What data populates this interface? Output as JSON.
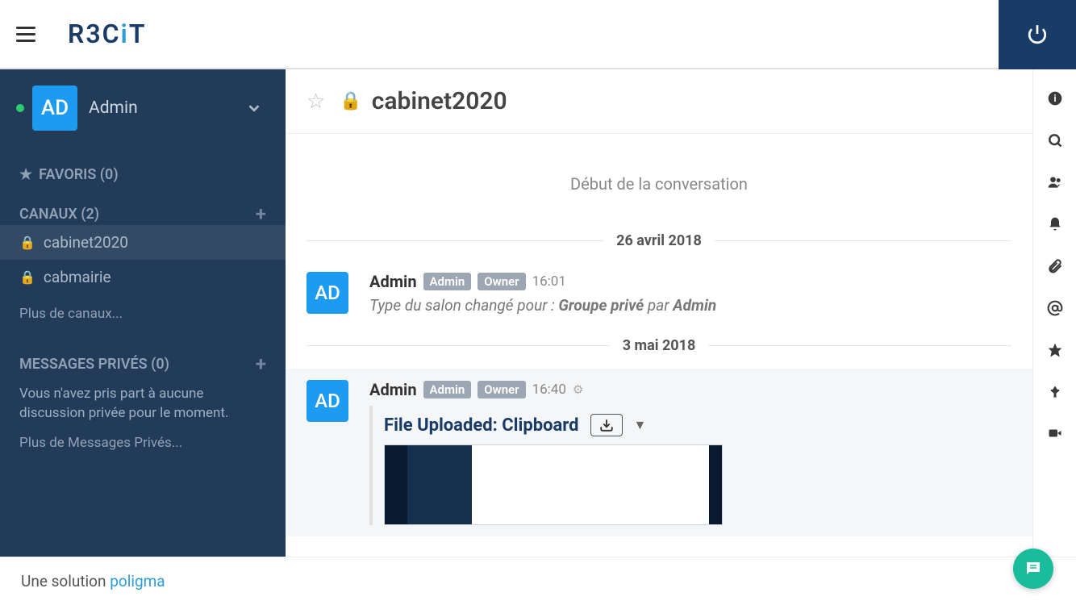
{
  "topbar": {
    "logo_pre": "R3C",
    "logo_i": "i",
    "logo_post": "T"
  },
  "sidebar": {
    "user": {
      "avatar": "AD",
      "name": "Admin"
    },
    "favoris": {
      "label": "FAVORIS (0)"
    },
    "canaux": {
      "label": "CANAUX (2)",
      "items": [
        {
          "name": "cabinet2020",
          "active": true
        },
        {
          "name": "cabmairie",
          "active": false
        }
      ],
      "more": "Plus de canaux..."
    },
    "dm": {
      "label": "MESSAGES PRIVÉS (0)",
      "empty": "Vous n'avez pris part à aucune discussion privée pour le moment.",
      "more": "Plus de Messages Privés..."
    }
  },
  "chat": {
    "title": "cabinet2020",
    "start": "Début de la conversation",
    "dates": [
      "26 avril 2018",
      "3 mai 2018"
    ],
    "msg1": {
      "avatar": "AD",
      "name": "Admin",
      "b1": "Admin",
      "b2": "Owner",
      "time": "16:01",
      "text_pre": "Type du salon changé pour : ",
      "text_b": "Groupe privé",
      "text_mid": " par ",
      "text_b2": "Admin"
    },
    "msg2": {
      "avatar": "AD",
      "name": "Admin",
      "b1": "Admin",
      "b2": "Owner",
      "time": "16:40",
      "att_title": "File Uploaded: Clipboard"
    }
  },
  "footer": {
    "pre": "Une solution ",
    "link": "poligma"
  }
}
